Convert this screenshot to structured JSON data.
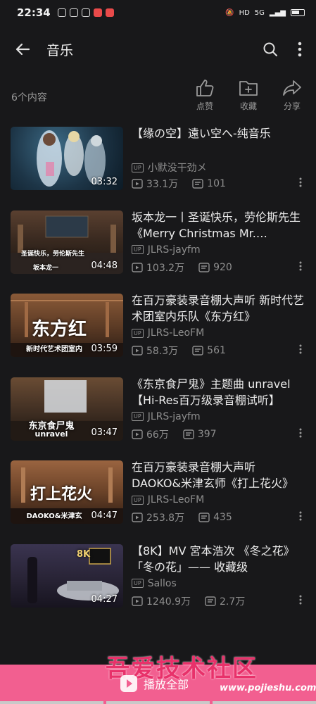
{
  "status": {
    "time": "22:34",
    "net": "5G",
    "hd": "HD"
  },
  "appbar": {
    "title": "音乐"
  },
  "summary": {
    "count": "6个内容",
    "like_label": "点赞",
    "collect_label": "收藏",
    "share_label": "分享"
  },
  "videos": [
    {
      "title": "【缘の空】遠い空へ-纯音乐",
      "uploader": "小默没干劲メ",
      "views": "33.1万",
      "comments": "101",
      "duration": "03:32",
      "overlay_line1": "",
      "overlay_line2": ""
    },
    {
      "title": "坂本龙一丨圣诞快乐，劳伦斯先生《Merry Christmas Mr. Lawrence》",
      "uploader": "JLRS-jayfm",
      "views": "103.2万",
      "comments": "920",
      "duration": "04:48",
      "overlay_line1": "圣诞快乐，劳伦斯先生",
      "overlay_line2": "坂本龙一"
    },
    {
      "title": "在百万豪装录音棚大声听 新时代艺术团室内乐队《东方红》",
      "uploader": "JLRS-LeoFM",
      "views": "58.3万",
      "comments": "561",
      "duration": "03:59",
      "overlay_line1": "东方红",
      "overlay_line2": "新时代艺术团室内"
    },
    {
      "title": "《东京食尸鬼》主题曲 unravel【Hi-Res百万级录音棚试听】",
      "uploader": "JLRS-jayfm",
      "views": "66万",
      "comments": "397",
      "duration": "03:47",
      "overlay_line1": "东京食尸鬼",
      "overlay_line2": "unravel"
    },
    {
      "title": "在百万豪装录音棚大声听 DAOKO&米津玄师《打上花火》",
      "uploader": "JLRS-LeoFM",
      "views": "253.8万",
      "comments": "435",
      "duration": "04:47",
      "overlay_line1": "打上花火",
      "overlay_line2": "DAOKO&米津玄"
    },
    {
      "title": "【8K】MV 宮本浩次 《冬之花》「冬の花」—— 收藏级",
      "uploader": "Sallos",
      "views": "1240.9万",
      "comments": "2.7万",
      "duration": "04:27",
      "overlay_line1": "8K",
      "overlay_line2": ""
    }
  ],
  "footer": {
    "play_all": "播放全部",
    "watermark": "吾爱技术社区",
    "watermark_url": "www.pojieshu.com"
  },
  "colors": {
    "background": "#18181a",
    "accent": "#f25f90"
  }
}
